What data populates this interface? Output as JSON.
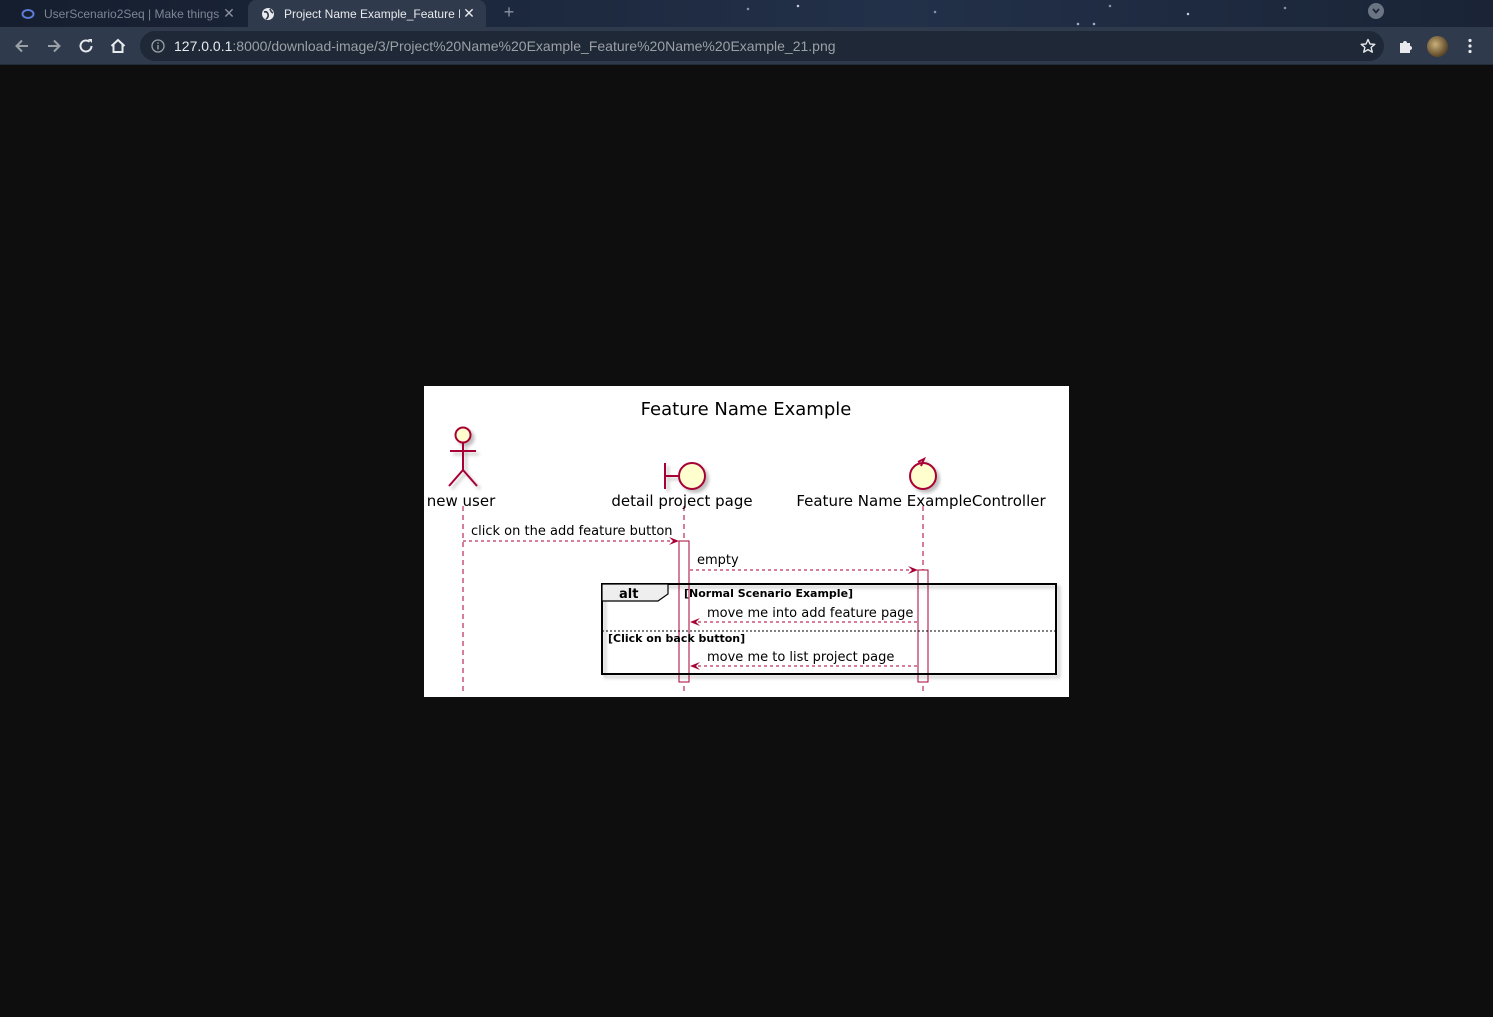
{
  "browser": {
    "tabs": [
      {
        "title": "UserScenario2Seq | Make things",
        "active": false,
        "icon": "google-cloud-icon"
      },
      {
        "title": "Project Name Example_Feature Name Example_21.png",
        "active": true,
        "icon": "globe-icon"
      }
    ],
    "new_tab_label": "+",
    "address": {
      "host": "127.0.0.1",
      "rest": ":8000/download-image/3/Project%20Name%20Example_Feature%20Name%20Example_21.png"
    }
  },
  "diagram": {
    "title": "Feature Name Example",
    "participants": [
      {
        "name": "new user",
        "kind": "actor"
      },
      {
        "name": "detail project page",
        "kind": "boundary"
      },
      {
        "name": "Feature Name ExampleController",
        "kind": "control"
      }
    ],
    "messages": [
      {
        "from": "new user",
        "to": "detail project page",
        "text": "click on the add feature button"
      },
      {
        "from": "detail project page",
        "to": "Feature Name ExampleController",
        "text": "empty"
      },
      {
        "from": "Feature Name ExampleController",
        "to": "detail project page",
        "text": "move me into add feature page"
      },
      {
        "from": "Feature Name ExampleController",
        "to": "detail project page",
        "text": "move me to list project page"
      }
    ],
    "fragment": {
      "keyword": "alt",
      "guard1": "[Normal Scenario Example]",
      "guard2": "[Click on back button]"
    },
    "colors": {
      "line": "#a80036",
      "fill": "#fefece",
      "background": "#ffffff"
    }
  }
}
